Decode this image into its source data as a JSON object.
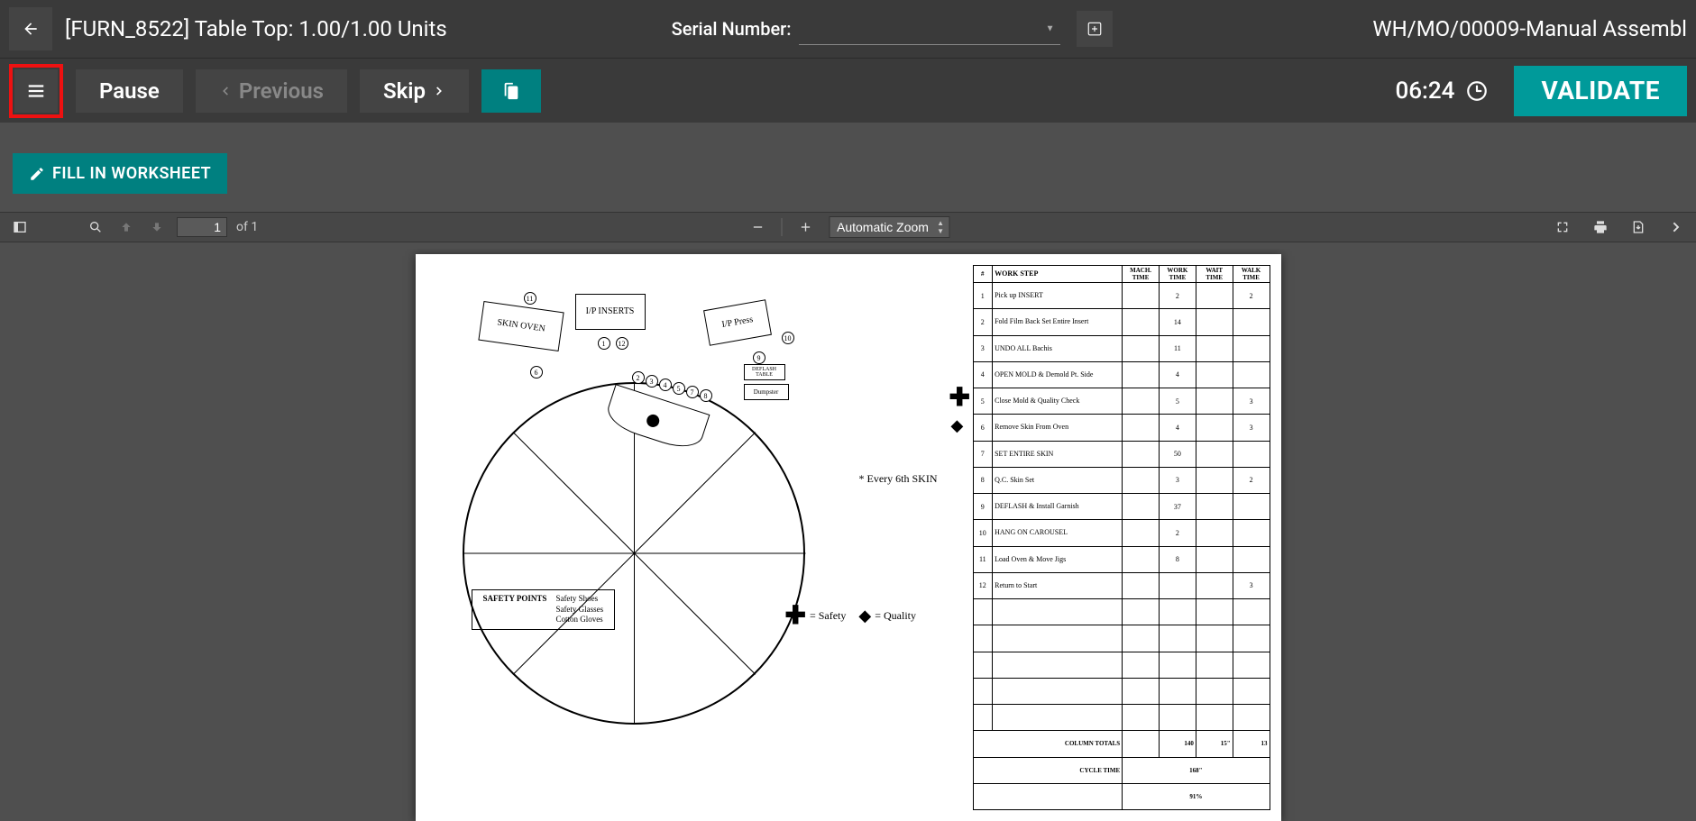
{
  "header": {
    "title": "[FURN_8522] Table Top: 1.00/1.00 Units",
    "serial_label": "Serial Number:",
    "wo_title": "WH/MO/00009-Manual Assembl"
  },
  "actions": {
    "pause": "Pause",
    "previous": "Previous",
    "skip": "Skip",
    "timer": "06:24",
    "validate": "VALIDATE"
  },
  "content": {
    "fill_worksheet": "FILL IN WORKSHEET"
  },
  "pdf": {
    "page_current": "1",
    "page_of": "of 1",
    "zoom": "Automatic Zoom"
  },
  "diagram": {
    "skin_oven": "SKIN OVEN",
    "ip_inserts": "I/P INSERTS",
    "ip_press": "I/P Press",
    "deflash": "DEFLASH TABLE",
    "dumpster": "Dumpster",
    "every6": "* Every 6th SKIN",
    "safety_label": "SAFETY POINTS",
    "safety_items": "Safety Shoes\nSafety Glasses\nCotton Gloves",
    "legend_safety": "= Safety",
    "legend_quality": "= Quality"
  },
  "table": {
    "headers": {
      "num": "#",
      "workstep": "WORK STEP",
      "mach": "MACH. TIME",
      "work": "WORK TIME",
      "wait": "WAIT TIME",
      "walk": "WALK TIME"
    },
    "rows": [
      {
        "n": "1",
        "step": "Pick up INSERT",
        "mach": "",
        "work": "2",
        "wait": "",
        "walk": "2"
      },
      {
        "n": "2",
        "step": "Fold Film Back Set Entire Insert",
        "mach": "",
        "work": "14",
        "wait": "",
        "walk": ""
      },
      {
        "n": "3",
        "step": "UNDO ALL Bachis",
        "mach": "",
        "work": "11",
        "wait": "",
        "walk": ""
      },
      {
        "n": "4",
        "step": "OPEN MOLD & Demold Pt. Side",
        "mach": "",
        "work": "4",
        "wait": "",
        "walk": ""
      },
      {
        "n": "5",
        "step": "Close Mold & Quality Check",
        "mach": "",
        "work": "5",
        "wait": "",
        "walk": "3"
      },
      {
        "n": "6",
        "step": "Remove Skin From Oven",
        "mach": "",
        "work": "4",
        "wait": "",
        "walk": "3"
      },
      {
        "n": "7",
        "step": "SET ENTIRE SKIN",
        "mach": "",
        "work": "50",
        "wait": "",
        "walk": ""
      },
      {
        "n": "8",
        "step": "Q.C. Skin Set",
        "mach": "",
        "work": "3",
        "wait": "",
        "walk": "2"
      },
      {
        "n": "9",
        "step": "DEFLASH & Install Garnish",
        "mach": "",
        "work": "37",
        "wait": "",
        "walk": ""
      },
      {
        "n": "10",
        "step": "HANG ON CAROUSEL",
        "mach": "",
        "work": "2",
        "wait": "",
        "walk": ""
      },
      {
        "n": "11",
        "step": "Load Oven & Move Jigs",
        "mach": "",
        "work": "8",
        "wait": "",
        "walk": ""
      },
      {
        "n": "12",
        "step": "Return to Start",
        "mach": "",
        "work": "",
        "wait": "",
        "walk": "3"
      }
    ],
    "totals_label": "COLUMN TOTALS",
    "totals": {
      "mach": "",
      "work": "140",
      "wait": "15\"",
      "walk": "13"
    },
    "cycle_label": "CYCLE TIME",
    "cycle_value": "168\"",
    "pct": "91%"
  }
}
